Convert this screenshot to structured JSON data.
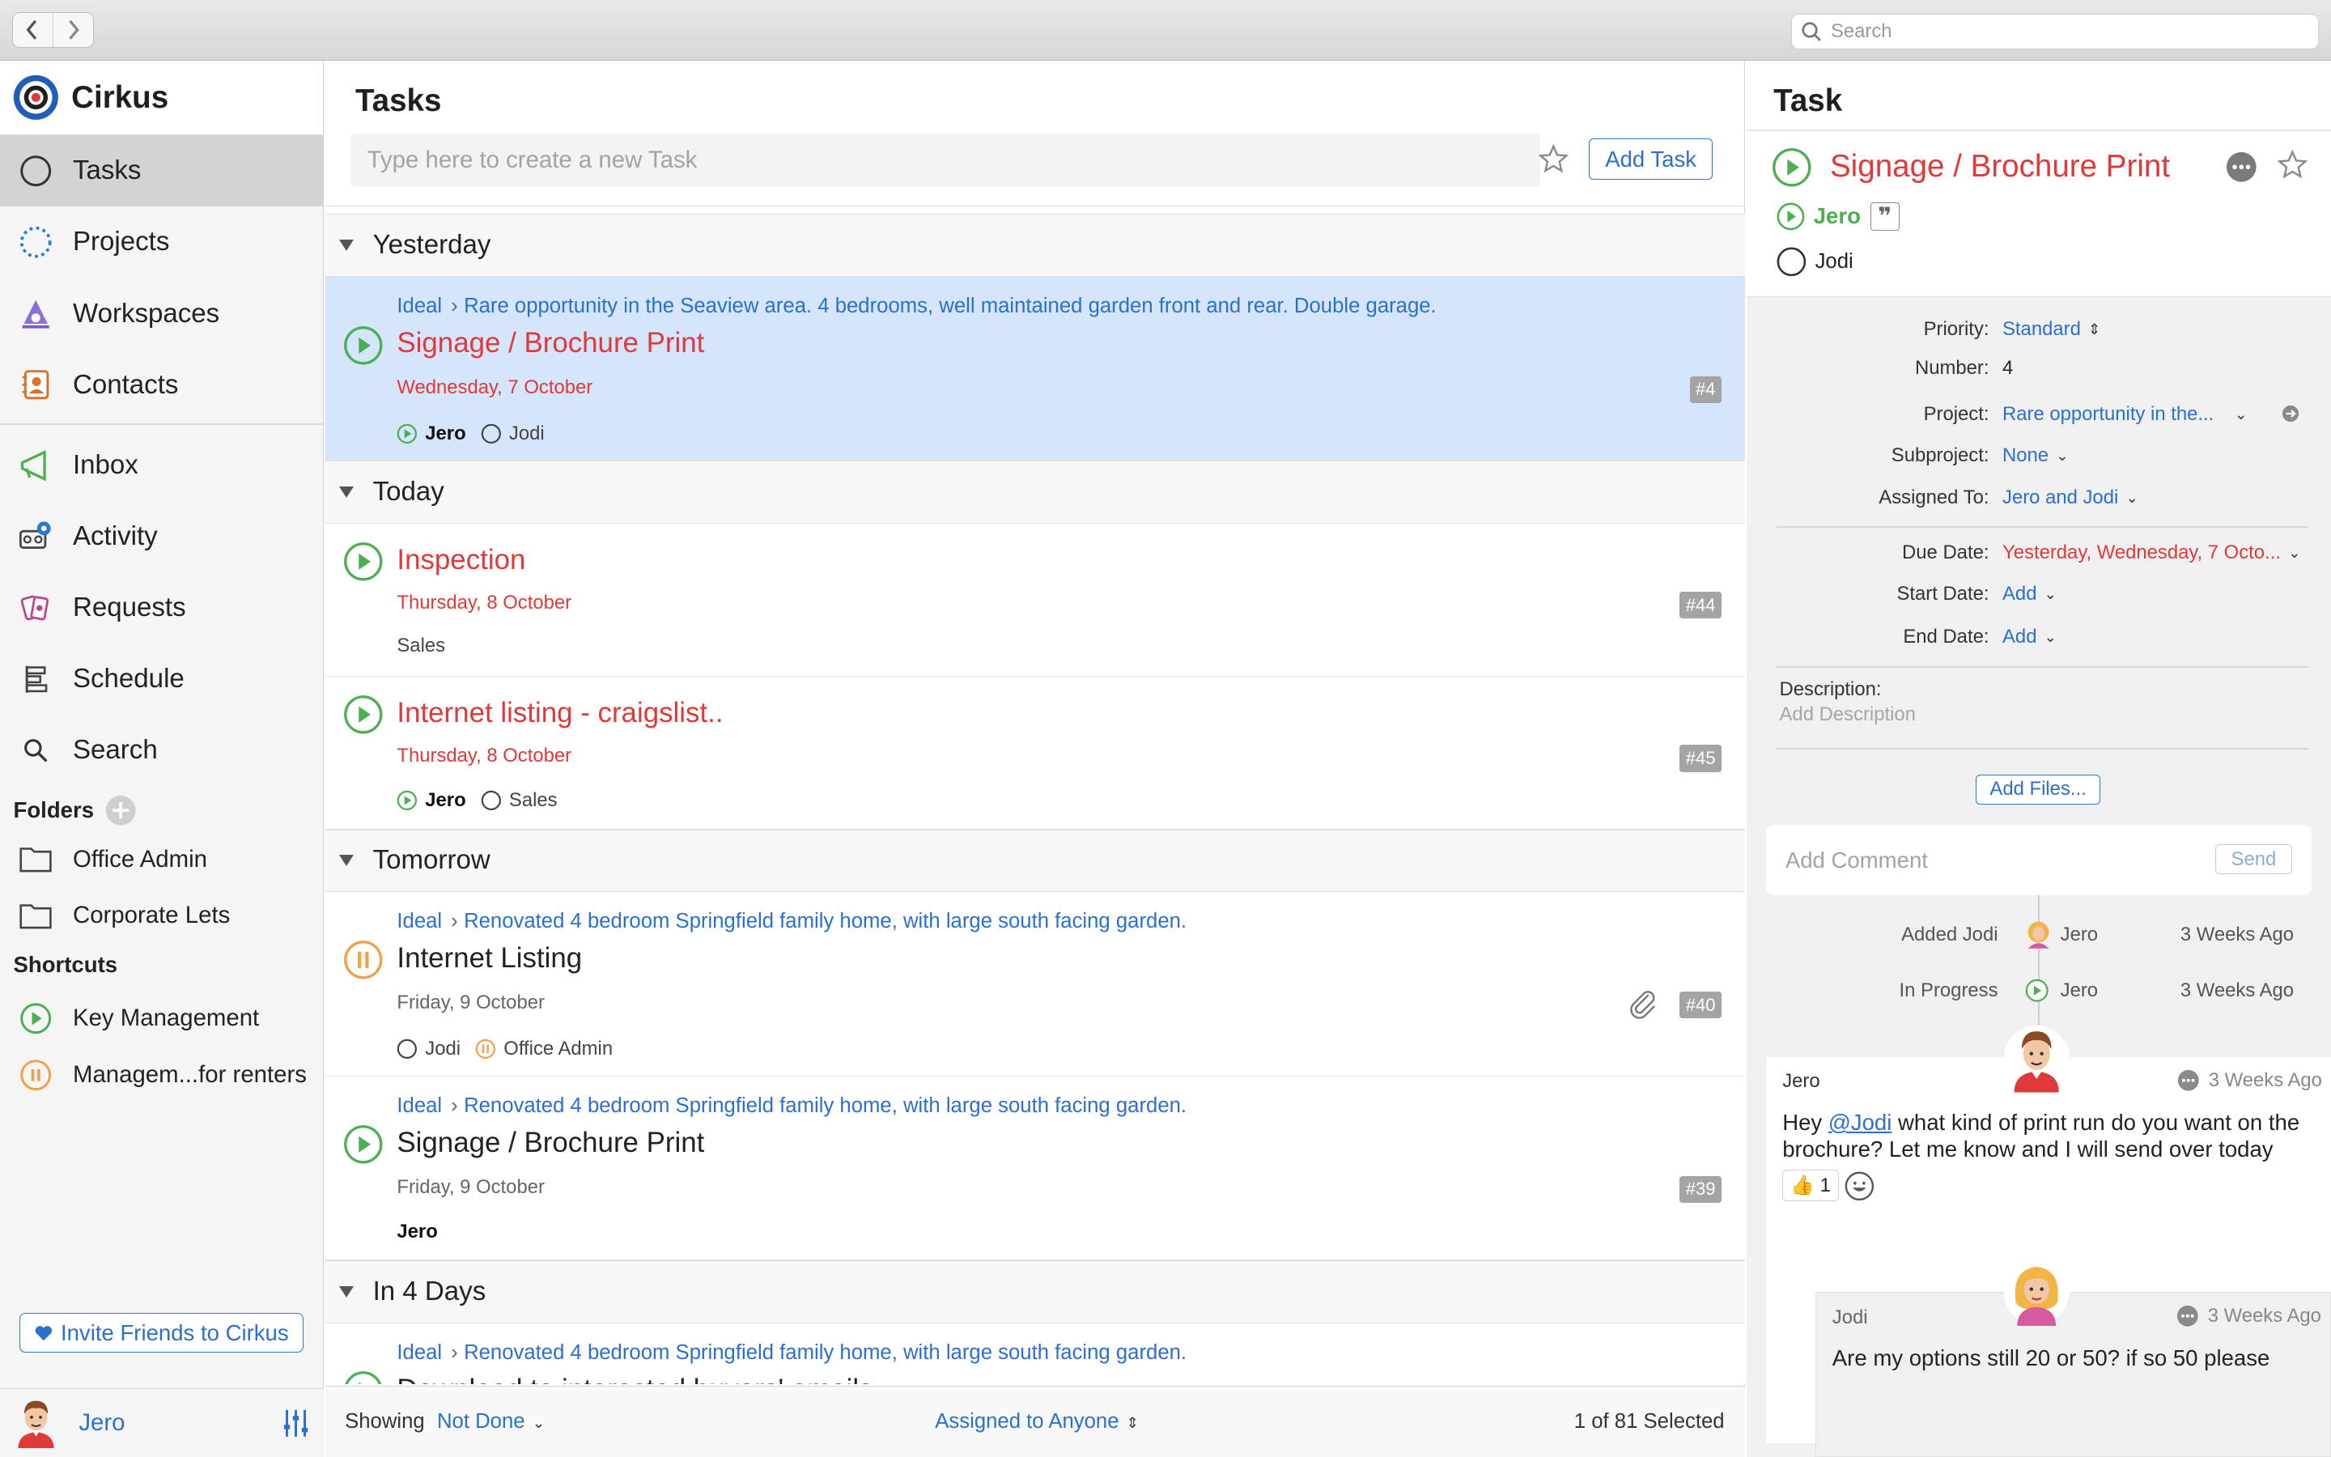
{
  "titlebar": {
    "search_placeholder": "Search"
  },
  "sidebar": {
    "app_name": "Cirkus",
    "nav": [
      {
        "label": "Tasks",
        "icon": "circle-icon"
      },
      {
        "label": "Projects",
        "icon": "dotted-circle-icon"
      },
      {
        "label": "Workspaces",
        "icon": "workspaces-icon"
      },
      {
        "label": "Contacts",
        "icon": "contacts-icon"
      },
      {
        "label": "Inbox",
        "icon": "megaphone-icon"
      },
      {
        "label": "Activity",
        "icon": "activity-icon"
      },
      {
        "label": "Requests",
        "icon": "requests-icon"
      },
      {
        "label": "Schedule",
        "icon": "schedule-icon"
      },
      {
        "label": "Search",
        "icon": "search-icon"
      }
    ],
    "folders_heading": "Folders",
    "folders": [
      "Office Admin",
      "Corporate Lets"
    ],
    "shortcuts_heading": "Shortcuts",
    "shortcuts": [
      "Key Management",
      "Managem...for renters"
    ],
    "invite_label": "Invite Friends to Cirkus",
    "user_name": "Jero"
  },
  "tasks": {
    "title": "Tasks",
    "new_task_placeholder": "Type here to create a new Task",
    "add_task_label": "Add Task",
    "groups": {
      "yesterday": "Yesterday",
      "today": "Today",
      "tomorrow": "Tomorrow",
      "in4days": "In 4 Days"
    },
    "items": [
      {
        "crumb_ws": "Ideal",
        "crumb_project": "Rare opportunity in the Seaview area. 4 bedrooms, well maintained garden front and rear. Double garage.",
        "title": "Signage / Brochure Print",
        "date": "Wednesday, 7 October",
        "assignee1": "Jero",
        "assignee2": "Jodi",
        "number": "#4"
      },
      {
        "title": "Inspection",
        "date": "Thursday, 8 October",
        "tag": "Sales",
        "number": "#44"
      },
      {
        "title": "Internet listing - craigslist..",
        "date": "Thursday, 8 October",
        "assignee1": "Jero",
        "assignee2": "Sales",
        "number": "#45"
      },
      {
        "crumb_ws": "Ideal",
        "crumb_project": "Renovated 4 bedroom Springfield family home, with large south facing garden.",
        "title": "Internet Listing",
        "date": "Friday, 9 October",
        "assignee1": "Jodi",
        "assignee2": "Office Admin",
        "number": "#40"
      },
      {
        "crumb_ws": "Ideal",
        "crumb_project": "Renovated 4 bedroom Springfield family home, with large south facing garden.",
        "title": "Signage / Brochure Print",
        "date": "Friday, 9 October",
        "assignee1": "Jero",
        "number": "#39"
      },
      {
        "crumb_ws": "Ideal",
        "crumb_project": "Renovated 4 bedroom Springfield family home, with large south facing garden.",
        "title": "Download to interested buyers' emails"
      }
    ],
    "footer": {
      "showing": "Showing",
      "filter": "Not Done",
      "assigned": "Assigned to Anyone",
      "selected": "1 of 81 Selected"
    }
  },
  "detail": {
    "title": "Task",
    "task_title": "Signage / Brochure Print",
    "owner": "Jero",
    "participant": "Jodi",
    "fields": {
      "priority_label": "Priority:",
      "priority_value": "Standard",
      "number_label": "Number:",
      "number_value": "4",
      "project_label": "Project:",
      "project_value": "Rare opportunity in the...",
      "subproject_label": "Subproject:",
      "subproject_value": "None",
      "assigned_label": "Assigned To:",
      "assigned_value": "Jero and Jodi",
      "due_label": "Due Date:",
      "due_value": "Yesterday, Wednesday, 7 Octo...",
      "start_label": "Start Date:",
      "start_value": "Add",
      "end_label": "End Date:",
      "end_value": "Add"
    },
    "description_label": "Description:",
    "description_placeholder": "Add Description",
    "add_files_label": "Add Files...",
    "comment_placeholder": "Add Comment",
    "send_label": "Send",
    "activity": [
      {
        "label": "Added Jodi",
        "who": "Jero",
        "time": "3 Weeks Ago"
      },
      {
        "label": "In Progress",
        "who": "Jero",
        "time": "3 Weeks Ago"
      }
    ],
    "comments": [
      {
        "author": "Jero",
        "time": "3 Weeks Ago",
        "text_before": "Hey ",
        "mention": "@Jodi",
        "text_after": " what kind of print run do you want on the brochure? Let me know and I will send over today",
        "reaction_count": "1"
      },
      {
        "author": "Jodi",
        "time": "3 Weeks Ago",
        "text": "Are my options still 20 or 50? if so 50 please"
      }
    ]
  },
  "colors": {
    "accent": "#2b6fcf",
    "danger": "#e0393a",
    "progress": "#4caf50",
    "paused": "#f0a04b"
  }
}
